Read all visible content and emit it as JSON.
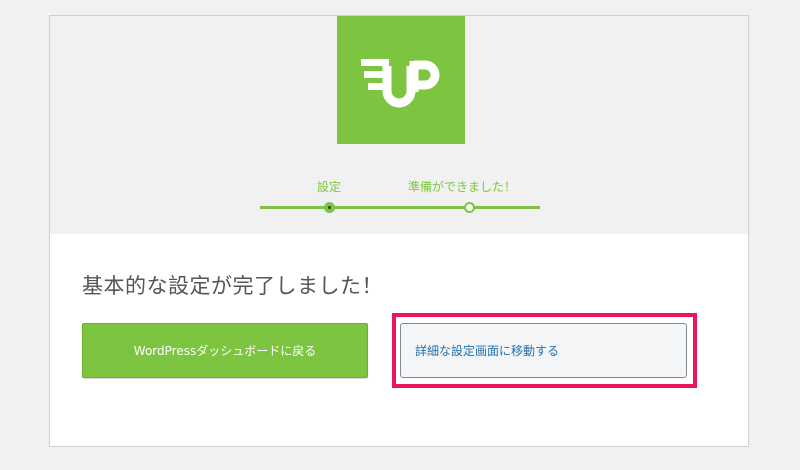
{
  "steps": [
    {
      "label": "設定"
    },
    {
      "label": "準備ができました！"
    }
  ],
  "main": {
    "title": "基本的な設定が完了しました！",
    "primary_button": "WordPressダッシュボードに戻る",
    "secondary_button": "詳細な設定画面に移動する"
  },
  "colors": {
    "accent": "#7dc540",
    "highlight": "#e8175d",
    "link": "#2271b1"
  },
  "icons": {
    "logo": "up-logo-icon"
  }
}
